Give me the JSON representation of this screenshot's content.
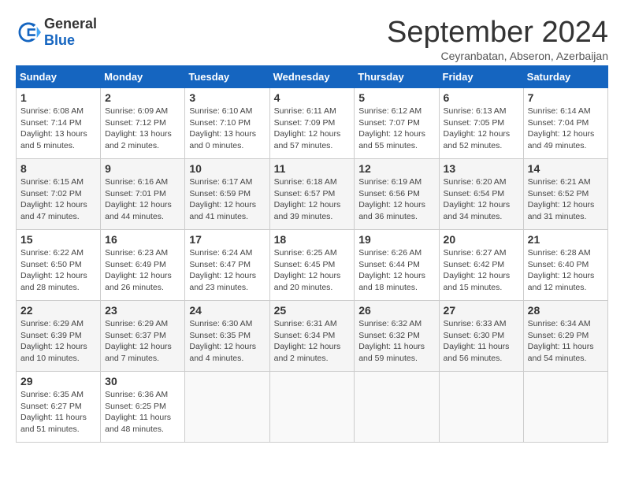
{
  "header": {
    "logo_general": "General",
    "logo_blue": "Blue",
    "title": "September 2024",
    "subtitle": "Ceyranbatan, Abseron, Azerbaijan"
  },
  "weekdays": [
    "Sunday",
    "Monday",
    "Tuesday",
    "Wednesday",
    "Thursday",
    "Friday",
    "Saturday"
  ],
  "weeks": [
    [
      {
        "day": "1",
        "detail": "Sunrise: 6:08 AM\nSunset: 7:14 PM\nDaylight: 13 hours\nand 5 minutes."
      },
      {
        "day": "2",
        "detail": "Sunrise: 6:09 AM\nSunset: 7:12 PM\nDaylight: 13 hours\nand 2 minutes."
      },
      {
        "day": "3",
        "detail": "Sunrise: 6:10 AM\nSunset: 7:10 PM\nDaylight: 13 hours\nand 0 minutes."
      },
      {
        "day": "4",
        "detail": "Sunrise: 6:11 AM\nSunset: 7:09 PM\nDaylight: 12 hours\nand 57 minutes."
      },
      {
        "day": "5",
        "detail": "Sunrise: 6:12 AM\nSunset: 7:07 PM\nDaylight: 12 hours\nand 55 minutes."
      },
      {
        "day": "6",
        "detail": "Sunrise: 6:13 AM\nSunset: 7:05 PM\nDaylight: 12 hours\nand 52 minutes."
      },
      {
        "day": "7",
        "detail": "Sunrise: 6:14 AM\nSunset: 7:04 PM\nDaylight: 12 hours\nand 49 minutes."
      }
    ],
    [
      {
        "day": "8",
        "detail": "Sunrise: 6:15 AM\nSunset: 7:02 PM\nDaylight: 12 hours\nand 47 minutes."
      },
      {
        "day": "9",
        "detail": "Sunrise: 6:16 AM\nSunset: 7:01 PM\nDaylight: 12 hours\nand 44 minutes."
      },
      {
        "day": "10",
        "detail": "Sunrise: 6:17 AM\nSunset: 6:59 PM\nDaylight: 12 hours\nand 41 minutes."
      },
      {
        "day": "11",
        "detail": "Sunrise: 6:18 AM\nSunset: 6:57 PM\nDaylight: 12 hours\nand 39 minutes."
      },
      {
        "day": "12",
        "detail": "Sunrise: 6:19 AM\nSunset: 6:56 PM\nDaylight: 12 hours\nand 36 minutes."
      },
      {
        "day": "13",
        "detail": "Sunrise: 6:20 AM\nSunset: 6:54 PM\nDaylight: 12 hours\nand 34 minutes."
      },
      {
        "day": "14",
        "detail": "Sunrise: 6:21 AM\nSunset: 6:52 PM\nDaylight: 12 hours\nand 31 minutes."
      }
    ],
    [
      {
        "day": "15",
        "detail": "Sunrise: 6:22 AM\nSunset: 6:50 PM\nDaylight: 12 hours\nand 28 minutes."
      },
      {
        "day": "16",
        "detail": "Sunrise: 6:23 AM\nSunset: 6:49 PM\nDaylight: 12 hours\nand 26 minutes."
      },
      {
        "day": "17",
        "detail": "Sunrise: 6:24 AM\nSunset: 6:47 PM\nDaylight: 12 hours\nand 23 minutes."
      },
      {
        "day": "18",
        "detail": "Sunrise: 6:25 AM\nSunset: 6:45 PM\nDaylight: 12 hours\nand 20 minutes."
      },
      {
        "day": "19",
        "detail": "Sunrise: 6:26 AM\nSunset: 6:44 PM\nDaylight: 12 hours\nand 18 minutes."
      },
      {
        "day": "20",
        "detail": "Sunrise: 6:27 AM\nSunset: 6:42 PM\nDaylight: 12 hours\nand 15 minutes."
      },
      {
        "day": "21",
        "detail": "Sunrise: 6:28 AM\nSunset: 6:40 PM\nDaylight: 12 hours\nand 12 minutes."
      }
    ],
    [
      {
        "day": "22",
        "detail": "Sunrise: 6:29 AM\nSunset: 6:39 PM\nDaylight: 12 hours\nand 10 minutes."
      },
      {
        "day": "23",
        "detail": "Sunrise: 6:29 AM\nSunset: 6:37 PM\nDaylight: 12 hours\nand 7 minutes."
      },
      {
        "day": "24",
        "detail": "Sunrise: 6:30 AM\nSunset: 6:35 PM\nDaylight: 12 hours\nand 4 minutes."
      },
      {
        "day": "25",
        "detail": "Sunrise: 6:31 AM\nSunset: 6:34 PM\nDaylight: 12 hours\nand 2 minutes."
      },
      {
        "day": "26",
        "detail": "Sunrise: 6:32 AM\nSunset: 6:32 PM\nDaylight: 11 hours\nand 59 minutes."
      },
      {
        "day": "27",
        "detail": "Sunrise: 6:33 AM\nSunset: 6:30 PM\nDaylight: 11 hours\nand 56 minutes."
      },
      {
        "day": "28",
        "detail": "Sunrise: 6:34 AM\nSunset: 6:29 PM\nDaylight: 11 hours\nand 54 minutes."
      }
    ],
    [
      {
        "day": "29",
        "detail": "Sunrise: 6:35 AM\nSunset: 6:27 PM\nDaylight: 11 hours\nand 51 minutes."
      },
      {
        "day": "30",
        "detail": "Sunrise: 6:36 AM\nSunset: 6:25 PM\nDaylight: 11 hours\nand 48 minutes."
      },
      {
        "day": "",
        "detail": ""
      },
      {
        "day": "",
        "detail": ""
      },
      {
        "day": "",
        "detail": ""
      },
      {
        "day": "",
        "detail": ""
      },
      {
        "day": "",
        "detail": ""
      }
    ]
  ]
}
